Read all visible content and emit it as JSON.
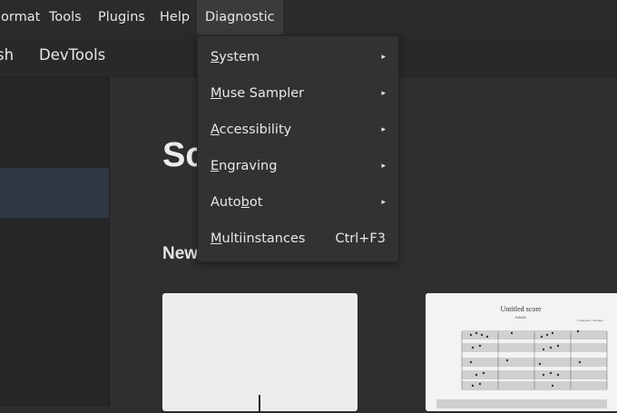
{
  "menubar": {
    "items": [
      {
        "label": "ormat"
      },
      {
        "label": "Tools"
      },
      {
        "label": "Plugins"
      },
      {
        "label": "Help"
      },
      {
        "label": "Diagnostic"
      }
    ]
  },
  "tabs": [
    {
      "label": "sh"
    },
    {
      "label": "DevTools"
    }
  ],
  "main": {
    "title": "Sc",
    "section_label": "New"
  },
  "score_thumbnail": {
    "title": "Untitled score",
    "subtitle": "Subtitle",
    "composer": "Composer / arranger"
  },
  "dropdown": {
    "items": [
      {
        "label": "System",
        "mnemonic": "S",
        "rest": "ystem",
        "has_submenu": true
      },
      {
        "label": "Muse Sampler",
        "mnemonic": "M",
        "rest": "use Sampler",
        "has_submenu": true
      },
      {
        "label": "Accessibility",
        "mnemonic": "A",
        "rest": "ccessibility",
        "has_submenu": true
      },
      {
        "label": "Engraving",
        "mnemonic": "E",
        "rest": "ngraving",
        "has_submenu": true
      },
      {
        "label": "Autobot",
        "pre": "Auto",
        "mnemonic": "b",
        "rest": "ot",
        "has_submenu": true
      },
      {
        "label": "Multiinstances",
        "mnemonic": "M",
        "rest": "ultiinstances",
        "shortcut": "Ctrl+F3",
        "has_submenu": false
      }
    ],
    "submenu_arrow": "▸"
  },
  "colors": {
    "background": "#2d2d2f",
    "menu_active": "#3b3b3e",
    "dropdown_bg": "#323234",
    "sidebar_selected": "#2e3845"
  }
}
